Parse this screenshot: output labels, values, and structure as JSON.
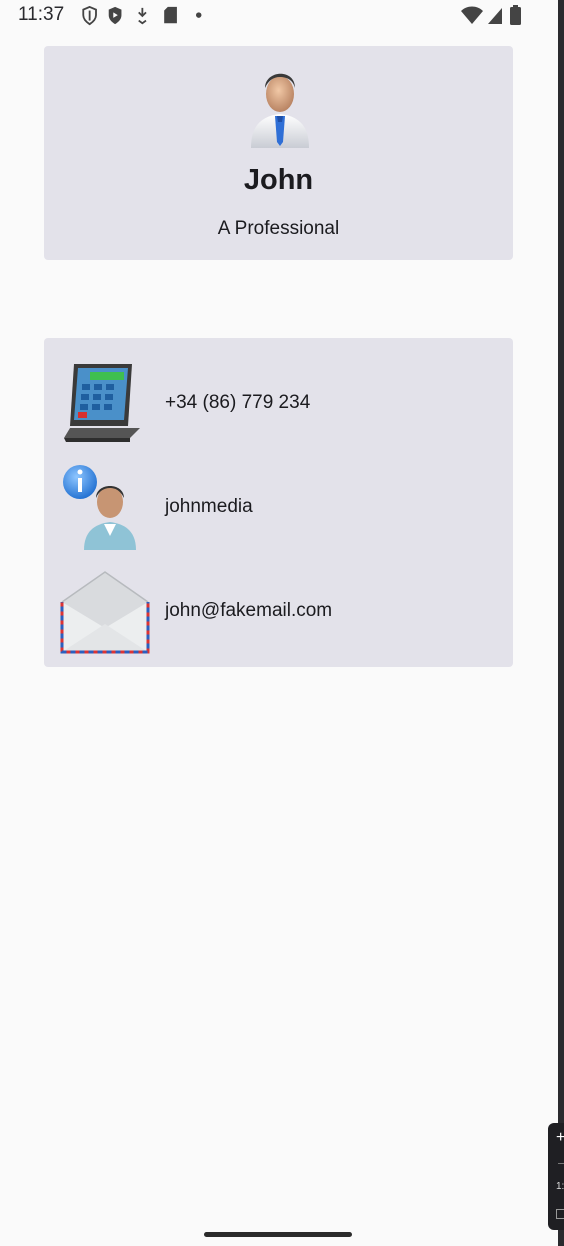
{
  "status_bar": {
    "time": "11:37",
    "left_icons": [
      "vpn-shield-icon",
      "play-protect-icon",
      "download-icon",
      "sd-card-icon",
      "dot-icon"
    ],
    "right_icons": [
      "wifi-icon",
      "signal-icon",
      "battery-icon"
    ]
  },
  "profile": {
    "avatar_icon": "businessman-avatar-icon",
    "name": "John",
    "title": "A Professional"
  },
  "contacts": [
    {
      "icon": "phone-calculator-icon",
      "value": "+34 (86) 779 234"
    },
    {
      "icon": "user-info-icon",
      "value": "johnmedia"
    },
    {
      "icon": "envelope-icon",
      "value": "john@fakemail.com"
    }
  ],
  "floating_widget": {
    "plus_label": "+",
    "text_label": "1:"
  }
}
